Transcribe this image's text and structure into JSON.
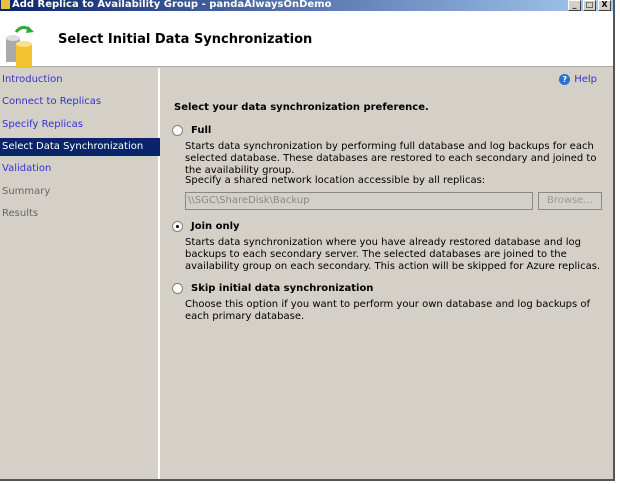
{
  "window": {
    "title": "Add Replica to Availability Group - pandaAlwaysOnDemo",
    "buttons": {
      "minimize": "_",
      "maximize": "□",
      "close": "X"
    }
  },
  "header": {
    "title": "Select Initial Data Synchronization"
  },
  "sidebar": {
    "items": [
      {
        "label": "Introduction",
        "state": "link"
      },
      {
        "label": "Connect to Replicas",
        "state": "link"
      },
      {
        "label": "Specify Replicas",
        "state": "link"
      },
      {
        "label": "Select Data Synchronization",
        "state": "selected"
      },
      {
        "label": "Validation",
        "state": "link"
      },
      {
        "label": "Summary",
        "state": "disabled"
      },
      {
        "label": "Results",
        "state": "disabled"
      }
    ]
  },
  "main": {
    "help": "Help",
    "prompt": "Select your data synchronization preference.",
    "options": [
      {
        "label": "Full",
        "selected": false,
        "description": "Starts data synchronization by performing full database and log backups for each selected database. These databases are restored to each secondary and joined to the availability group."
      },
      {
        "label": "Join only",
        "selected": true,
        "description": "Starts data synchronization where you have already restored database and log backups to each secondary server. The selected databases are joined to the availability group on each secondary. This action will be skipped for Azure replicas."
      },
      {
        "label": "Skip initial data synchronization",
        "selected": false,
        "description": "Choose this option if you want to perform your own database and log backups of each primary database."
      }
    ],
    "share_label": "Specify a shared network location accessible by all replicas:",
    "share_value": "\\\\SGC\\ShareDisk\\Backup",
    "browse": "Browse..."
  }
}
